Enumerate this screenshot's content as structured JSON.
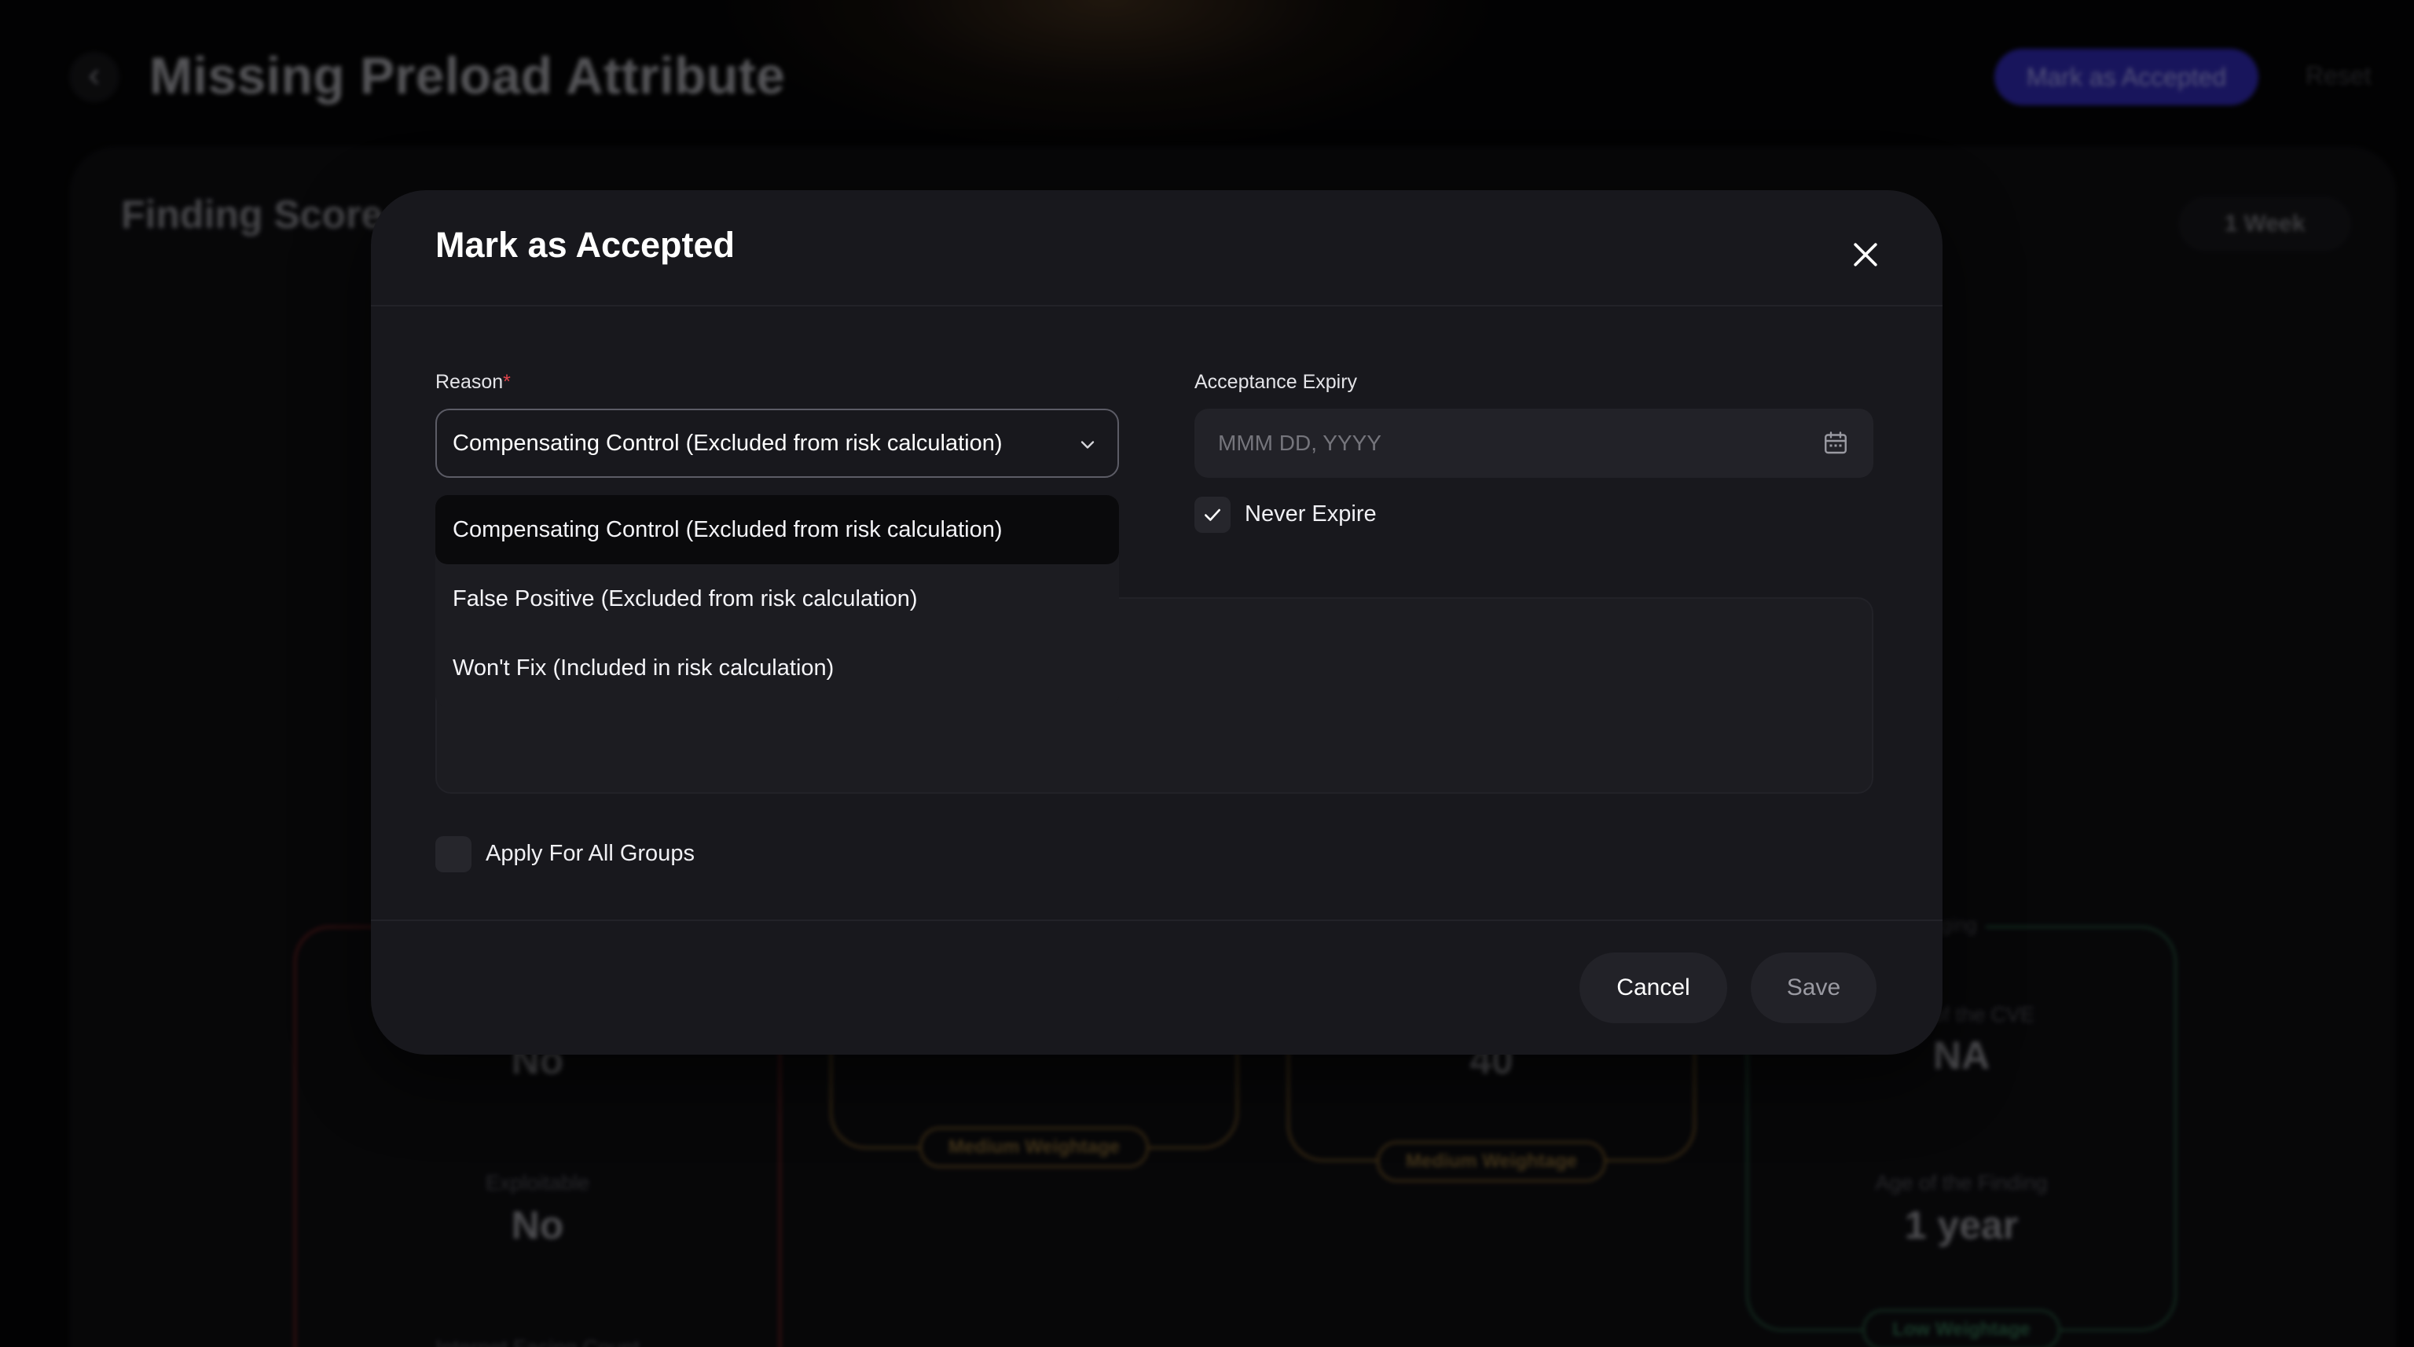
{
  "header": {
    "title": "Missing Preload Attribute",
    "mark_accepted_label": "Mark as Accepted",
    "reset_label": "Reset"
  },
  "panel": {
    "title": "Finding Score",
    "period_label": "1 Week"
  },
  "cards": {
    "exploitable": {
      "label_top_value": "No",
      "exploitable_label": "Exploitable",
      "exploitable_value": "No",
      "bottom_label": "Internet Facing Count"
    },
    "card2": {
      "tag": "Medium Weightage"
    },
    "card3": {
      "value": "40",
      "tag": "Medium Weightage"
    },
    "aging": {
      "title": "Aging",
      "age_cve_label": "Age of the CVE",
      "age_cve_value": "NA",
      "age_finding_label": "Age of the Finding",
      "age_finding_value": "1 year",
      "tag": "Low Weightage"
    }
  },
  "modal": {
    "title": "Mark as Accepted",
    "reason_label": "Reason",
    "reason_required_mark": "*",
    "reason_selected": "Compensating Control (Excluded from risk calculation)",
    "reason_options": [
      "Compensating Control (Excluded from risk calculation)",
      "False Positive (Excluded from risk calculation)",
      "Won't Fix (Included in risk calculation)"
    ],
    "expiry_label": "Acceptance Expiry",
    "expiry_placeholder": "MMM DD, YYYY",
    "never_expire_label": "Never Expire",
    "never_expire_checked": true,
    "apply_all_label": "Apply For All Groups",
    "apply_all_checked": false,
    "cancel_label": "Cancel",
    "save_label": "Save"
  },
  "colors": {
    "primary_button": "#2d27a8",
    "required": "#e0434b",
    "modal_bg": "#18181d"
  }
}
